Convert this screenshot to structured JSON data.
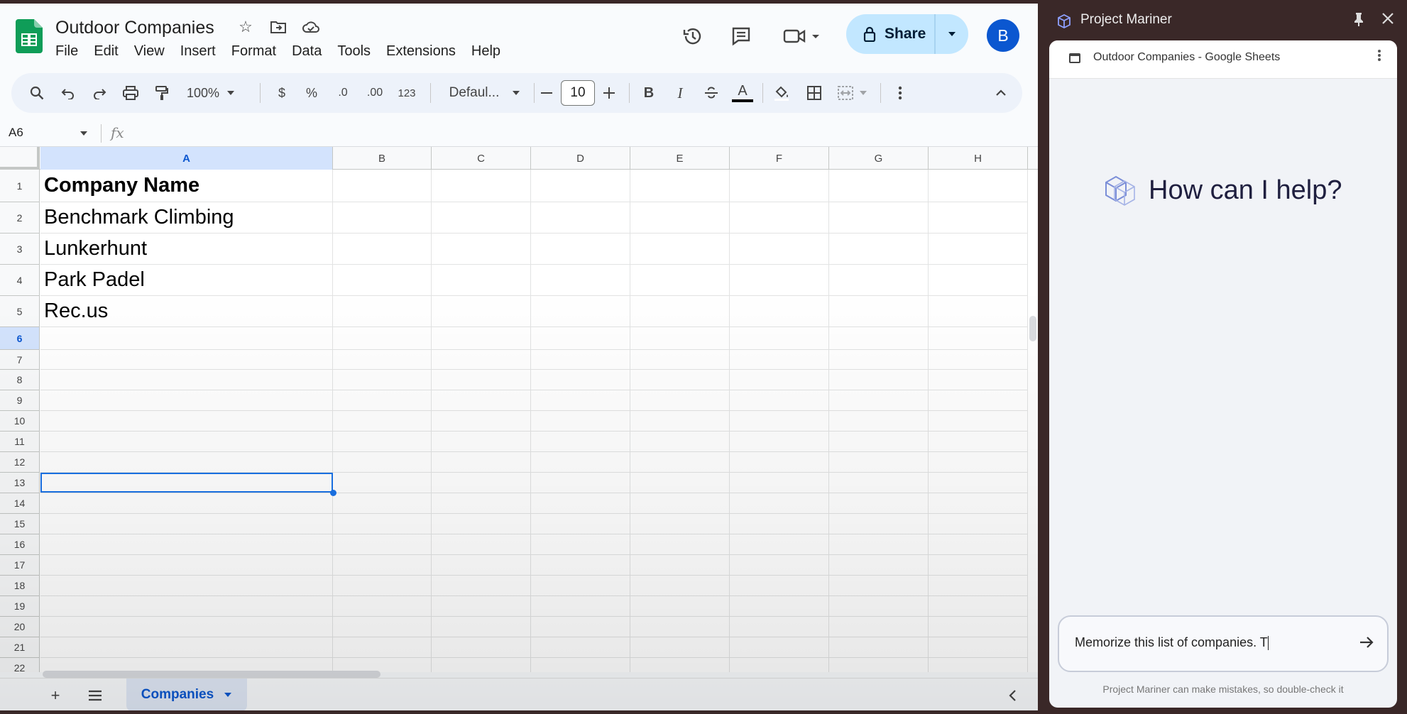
{
  "sheets": {
    "doc_title": "Outdoor Companies",
    "menu": [
      "File",
      "Edit",
      "View",
      "Insert",
      "Format",
      "Data",
      "Tools",
      "Extensions",
      "Help"
    ],
    "share_label": "Share",
    "avatar_letter": "B",
    "toolbar": {
      "zoom": "100%",
      "currency": "$",
      "percent": "%",
      "dec_decrease": ".0",
      "dec_increase": ".00",
      "number_format": "123",
      "font": "Defaul...",
      "font_size": "10",
      "bold": "B",
      "italic": "I",
      "text_color": "A"
    },
    "name_box": "A6",
    "fx": "fx",
    "columns": [
      "A",
      "B",
      "C",
      "D",
      "E",
      "F",
      "G",
      "H"
    ],
    "rows": [
      "1",
      "2",
      "3",
      "4",
      "5",
      "6",
      "7",
      "8",
      "9",
      "10",
      "11",
      "12",
      "13",
      "14",
      "15",
      "16",
      "17",
      "18",
      "19",
      "20",
      "21",
      "22"
    ],
    "cells": {
      "A1": "Company Name",
      "A2": "Benchmark Climbing",
      "A3": "Lunkerhunt",
      "A4": "Park Padel",
      "A5": "Rec.us"
    },
    "active_cell": "A6",
    "sheet_tab": "Companies"
  },
  "mariner": {
    "title": "Project Mariner",
    "tab_title": "Outdoor Companies - Google Sheets",
    "greeting": "How can I help?",
    "input_value": "Memorize this list of companies. T",
    "disclaimer": "Project Mariner can make mistakes, so double-check it"
  },
  "colors": {
    "sheets_green": "#0f9d58",
    "share_bg": "#c2e7ff",
    "avatar_bg": "#0b57d0",
    "selection": "#1a73e8",
    "mariner_frame": "#3a2828"
  }
}
